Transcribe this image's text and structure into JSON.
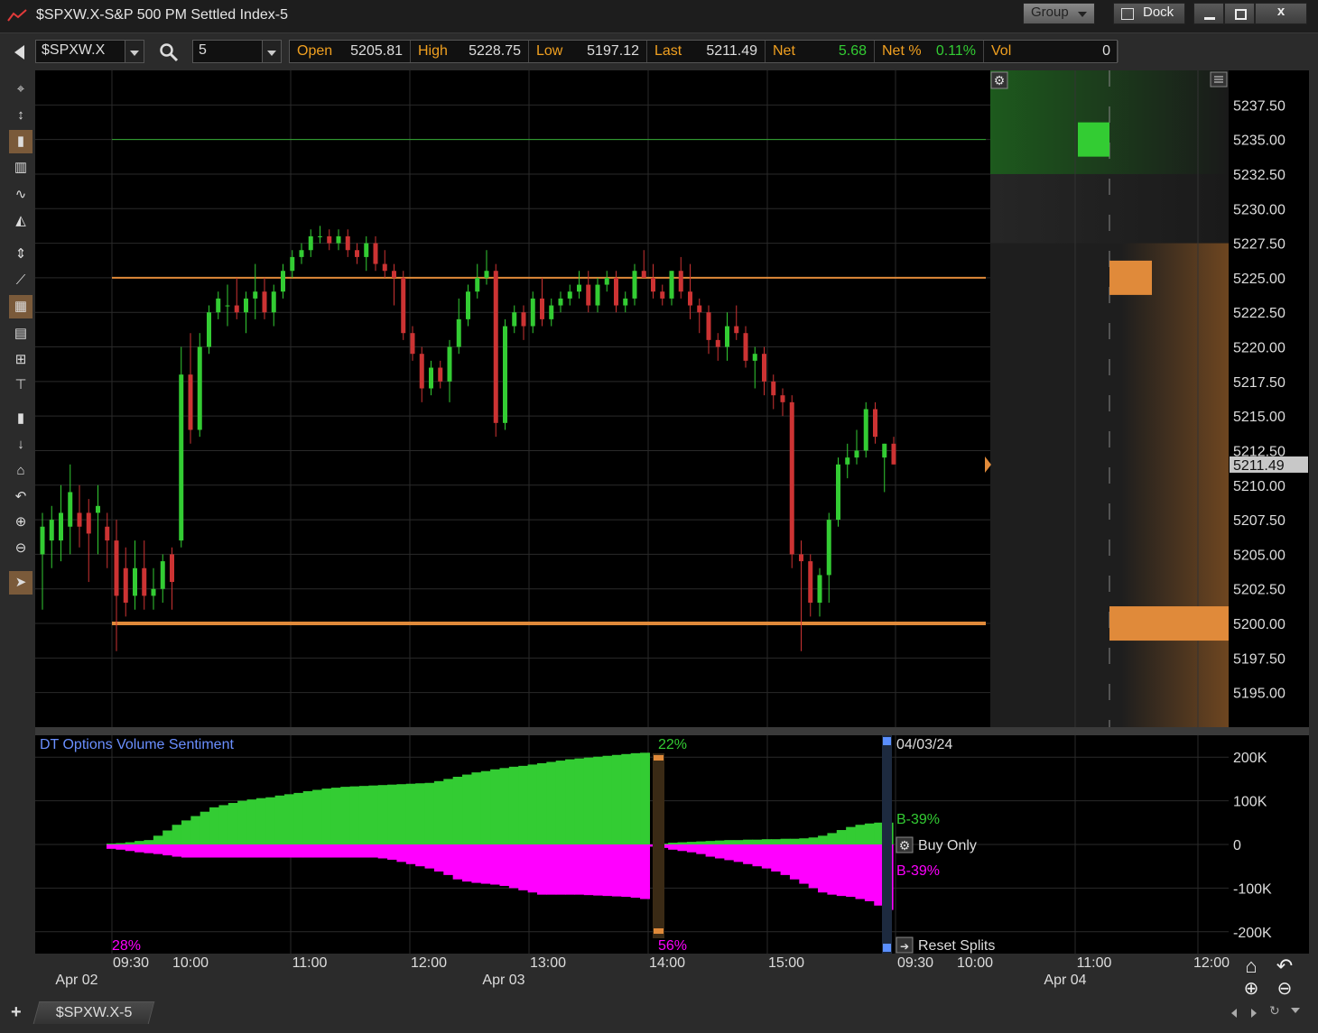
{
  "window": {
    "title": "$SPXW.X-S&P 500 PM Settled Index-5",
    "group_label": "Group",
    "dock_label": "Dock",
    "min_icon": "minimize-icon",
    "max_icon": "maximize-icon",
    "close_label": "x"
  },
  "toolbar": {
    "symbol": "$SPXW.X",
    "interval": "5",
    "quote": [
      {
        "label": "Open",
        "value": "5205.81",
        "color": "#dddddd"
      },
      {
        "label": "High",
        "value": "5228.75",
        "color": "#dddddd"
      },
      {
        "label": "Low",
        "value": "5197.12",
        "color": "#dddddd"
      },
      {
        "label": "Last",
        "value": "5211.49",
        "color": "#dddddd"
      },
      {
        "label": "Net",
        "value": "5.68",
        "color": "#33cc33"
      },
      {
        "label": "Net %",
        "value": "0.11%",
        "color": "#33cc33"
      },
      {
        "label": "Vol",
        "value": "0",
        "color": "#dddddd"
      }
    ]
  },
  "left_tools": [
    "crosshair-icon",
    "cursor-arrows-icon",
    "candlestick-icon",
    "bar-chart-icon",
    "line-chart-icon",
    "area-chart-icon",
    "fit-vertical-icon",
    "trendline-icon",
    "grid-icon",
    "table-icon",
    "small-grid-icon",
    "horizontal-line-icon",
    "scroll-right-icon",
    "scroll-down-icon",
    "home-icon",
    "undo-icon",
    "zoom-in-icon",
    "zoom-out-icon",
    "pointer-icon"
  ],
  "price_axis": {
    "ticks": [
      "5237.50",
      "5235.00",
      "5232.50",
      "5230.00",
      "5227.50",
      "5225.00",
      "5222.50",
      "5220.00",
      "5217.50",
      "5215.00",
      "5212.50",
      "5210.00",
      "5207.50",
      "5205.00",
      "5202.50",
      "5200.00",
      "5197.50",
      "5195.00"
    ],
    "last_price": "5211.49"
  },
  "indicator": {
    "title": "DT Options Volume Sentiment",
    "axis_ticks": [
      "200K",
      "100K",
      "0",
      "-100K",
      "-200K"
    ],
    "top_pct_1": "22%",
    "bottom_pct_0": "28%",
    "bottom_pct_1": "56%",
    "split_date": "04/03/24",
    "buy_label_top": "B-39%",
    "buy_label_bottom": "B-39%",
    "buy_only_label": "Buy Only",
    "reset_label": "Reset Splits"
  },
  "time_axis": {
    "times": [
      "09:30",
      "10:00",
      "11:00",
      "12:00",
      "13:00",
      "14:00",
      "15:00",
      "09:30",
      "10:00",
      "11:00",
      "12:00"
    ],
    "dates": [
      "Apr 02",
      "Apr 03",
      "Apr 04"
    ]
  },
  "tab": {
    "label": "$SPXW.X-5",
    "add_label": "+"
  },
  "colors": {
    "up": "#33cc33",
    "down": "#cc3333",
    "level": "#e08a3a",
    "green_line": "#33aa33",
    "magenta": "#ff00ff"
  },
  "chart_data": {
    "type": "candlestick",
    "price_range": [
      5192.5,
      5240.0
    ],
    "horizontal_lines": [
      5235.0,
      5225.0,
      5200.0
    ],
    "candles": [
      {
        "o": 5205,
        "h": 5208,
        "l": 5201,
        "c": 5207
      },
      {
        "o": 5206,
        "h": 5208.5,
        "l": 5204,
        "c": 5207.5
      },
      {
        "o": 5206,
        "h": 5210,
        "l": 5204.5,
        "c": 5208
      },
      {
        "o": 5207,
        "h": 5211.5,
        "l": 5205,
        "c": 5209.5
      },
      {
        "o": 5208,
        "h": 5210,
        "l": 5205.5,
        "c": 5207
      },
      {
        "o": 5208,
        "h": 5209,
        "l": 5203,
        "c": 5206.5
      },
      {
        "o": 5208,
        "h": 5210,
        "l": 5205,
        "c": 5208.5
      },
      {
        "o": 5207,
        "h": 5208,
        "l": 5204,
        "c": 5206
      },
      {
        "o": 5206,
        "h": 5207.5,
        "l": 5198,
        "c": 5202
      },
      {
        "o": 5204,
        "h": 5205.5,
        "l": 5200.5,
        "c": 5201.5
      },
      {
        "o": 5202,
        "h": 5206,
        "l": 5201,
        "c": 5204
      },
      {
        "o": 5204,
        "h": 5206,
        "l": 5201,
        "c": 5202
      },
      {
        "o": 5202,
        "h": 5204,
        "l": 5201,
        "c": 5202.5
      },
      {
        "o": 5202.5,
        "h": 5205,
        "l": 5201.5,
        "c": 5204.5
      },
      {
        "o": 5205,
        "h": 5205.5,
        "l": 5201,
        "c": 5203
      },
      {
        "o": 5206,
        "h": 5220,
        "l": 5205.5,
        "c": 5218
      },
      {
        "o": 5218,
        "h": 5221,
        "l": 5213,
        "c": 5214
      },
      {
        "o": 5214,
        "h": 5221,
        "l": 5213.5,
        "c": 5220
      },
      {
        "o": 5220,
        "h": 5223,
        "l": 5219.5,
        "c": 5222.5
      },
      {
        "o": 5222.5,
        "h": 5224,
        "l": 5222,
        "c": 5223.5
      },
      {
        "o": 5223,
        "h": 5224.5,
        "l": 5221.5,
        "c": 5223
      },
      {
        "o": 5223,
        "h": 5225,
        "l": 5222,
        "c": 5222.5
      },
      {
        "o": 5222.5,
        "h": 5224,
        "l": 5221,
        "c": 5223.5
      },
      {
        "o": 5223.5,
        "h": 5226,
        "l": 5222,
        "c": 5224
      },
      {
        "o": 5224,
        "h": 5225,
        "l": 5222,
        "c": 5222.5
      },
      {
        "o": 5222.5,
        "h": 5224.5,
        "l": 5221.5,
        "c": 5224
      },
      {
        "o": 5224,
        "h": 5226,
        "l": 5223.5,
        "c": 5225.5
      },
      {
        "o": 5225.5,
        "h": 5227,
        "l": 5225,
        "c": 5226.5
      },
      {
        "o": 5226.5,
        "h": 5227.5,
        "l": 5226,
        "c": 5227
      },
      {
        "o": 5227,
        "h": 5228.5,
        "l": 5226.5,
        "c": 5228
      },
      {
        "o": 5228,
        "h": 5228.75,
        "l": 5227.5,
        "c": 5228
      },
      {
        "o": 5228,
        "h": 5228.5,
        "l": 5227,
        "c": 5227.5
      },
      {
        "o": 5227.5,
        "h": 5228.5,
        "l": 5227,
        "c": 5228
      },
      {
        "o": 5228,
        "h": 5228.5,
        "l": 5226.5,
        "c": 5227
      },
      {
        "o": 5227,
        "h": 5227.5,
        "l": 5226,
        "c": 5226.5
      },
      {
        "o": 5226.5,
        "h": 5228,
        "l": 5225.5,
        "c": 5227.5
      },
      {
        "o": 5227.5,
        "h": 5228,
        "l": 5225.5,
        "c": 5226
      },
      {
        "o": 5226,
        "h": 5227,
        "l": 5225,
        "c": 5225.5
      },
      {
        "o": 5225.5,
        "h": 5226,
        "l": 5223,
        "c": 5225
      },
      {
        "o": 5225,
        "h": 5225.5,
        "l": 5220.5,
        "c": 5221
      },
      {
        "o": 5221,
        "h": 5221.5,
        "l": 5219,
        "c": 5219.5
      },
      {
        "o": 5219.5,
        "h": 5220,
        "l": 5216,
        "c": 5217
      },
      {
        "o": 5217,
        "h": 5219,
        "l": 5216.5,
        "c": 5218.5
      },
      {
        "o": 5218.5,
        "h": 5219,
        "l": 5217,
        "c": 5217.5
      },
      {
        "o": 5217.5,
        "h": 5220.5,
        "l": 5216,
        "c": 5220
      },
      {
        "o": 5220,
        "h": 5223.5,
        "l": 5219.5,
        "c": 5222
      },
      {
        "o": 5222,
        "h": 5224.5,
        "l": 5221.5,
        "c": 5224
      },
      {
        "o": 5224,
        "h": 5226,
        "l": 5223.5,
        "c": 5225
      },
      {
        "o": 5225,
        "h": 5227,
        "l": 5224.5,
        "c": 5225.5
      },
      {
        "o": 5225.5,
        "h": 5226,
        "l": 5213.5,
        "c": 5214.5
      },
      {
        "o": 5214.5,
        "h": 5222,
        "l": 5214,
        "c": 5221.5
      },
      {
        "o": 5221.5,
        "h": 5223,
        "l": 5221,
        "c": 5222.5
      },
      {
        "o": 5222.5,
        "h": 5223,
        "l": 5220.5,
        "c": 5221.5
      },
      {
        "o": 5221.5,
        "h": 5224,
        "l": 5221,
        "c": 5223.5
      },
      {
        "o": 5223.5,
        "h": 5225,
        "l": 5221.5,
        "c": 5222
      },
      {
        "o": 5222,
        "h": 5223.5,
        "l": 5221.5,
        "c": 5223
      },
      {
        "o": 5223,
        "h": 5224,
        "l": 5222.5,
        "c": 5223.5
      },
      {
        "o": 5223.5,
        "h": 5224.5,
        "l": 5223,
        "c": 5224
      },
      {
        "o": 5224,
        "h": 5225.5,
        "l": 5223.5,
        "c": 5224.5
      },
      {
        "o": 5224.5,
        "h": 5225.5,
        "l": 5222.5,
        "c": 5223
      },
      {
        "o": 5223,
        "h": 5225,
        "l": 5222.5,
        "c": 5224.5
      },
      {
        "o": 5224.5,
        "h": 5225.5,
        "l": 5224,
        "c": 5225
      },
      {
        "o": 5225,
        "h": 5225.5,
        "l": 5222.5,
        "c": 5223
      },
      {
        "o": 5223,
        "h": 5224,
        "l": 5222.5,
        "c": 5223.5
      },
      {
        "o": 5223.5,
        "h": 5226,
        "l": 5223,
        "c": 5225.5
      },
      {
        "o": 5225.5,
        "h": 5227,
        "l": 5225,
        "c": 5225
      },
      {
        "o": 5225,
        "h": 5226,
        "l": 5223.5,
        "c": 5224
      },
      {
        "o": 5224,
        "h": 5224.5,
        "l": 5223,
        "c": 5223.5
      },
      {
        "o": 5223.5,
        "h": 5225.5,
        "l": 5223,
        "c": 5225.5
      },
      {
        "o": 5225.5,
        "h": 5226.5,
        "l": 5223.5,
        "c": 5224
      },
      {
        "o": 5224,
        "h": 5226,
        "l": 5222,
        "c": 5223
      },
      {
        "o": 5223,
        "h": 5223.5,
        "l": 5221,
        "c": 5222.5
      },
      {
        "o": 5222.5,
        "h": 5223,
        "l": 5219.5,
        "c": 5220.5
      },
      {
        "o": 5220.5,
        "h": 5221,
        "l": 5219,
        "c": 5220
      },
      {
        "o": 5220,
        "h": 5222.5,
        "l": 5219,
        "c": 5221.5
      },
      {
        "o": 5221.5,
        "h": 5223,
        "l": 5220.5,
        "c": 5221
      },
      {
        "o": 5221,
        "h": 5221.5,
        "l": 5218.5,
        "c": 5219
      },
      {
        "o": 5219,
        "h": 5220,
        "l": 5217,
        "c": 5219.5
      },
      {
        "o": 5219.5,
        "h": 5220,
        "l": 5216.5,
        "c": 5217.5
      },
      {
        "o": 5217.5,
        "h": 5218,
        "l": 5215.5,
        "c": 5216.5
      },
      {
        "o": 5216.5,
        "h": 5217,
        "l": 5215,
        "c": 5216
      },
      {
        "o": 5216,
        "h": 5216.5,
        "l": 5204,
        "c": 5205
      },
      {
        "o": 5205,
        "h": 5206,
        "l": 5198,
        "c": 5204.5
      },
      {
        "o": 5204.5,
        "h": 5205,
        "l": 5200.5,
        "c": 5201.5
      },
      {
        "o": 5201.5,
        "h": 5204,
        "l": 5200.5,
        "c": 5203.5
      },
      {
        "o": 5203.5,
        "h": 5208,
        "l": 5201.5,
        "c": 5207.5
      },
      {
        "o": 5207.5,
        "h": 5212,
        "l": 5207,
        "c": 5211.5
      },
      {
        "o": 5211.5,
        "h": 5213,
        "l": 5210.5,
        "c": 5212
      },
      {
        "o": 5212,
        "h": 5214,
        "l": 5211.5,
        "c": 5212.5
      },
      {
        "o": 5212.5,
        "h": 5216,
        "l": 5212,
        "c": 5215.5
      },
      {
        "o": 5215.5,
        "h": 5216,
        "l": 5213,
        "c": 5213.5
      },
      {
        "o": 5212,
        "h": 5213,
        "l": 5209.5,
        "c": 5213
      },
      {
        "o": 5213,
        "h": 5213.5,
        "l": 5211.5,
        "c": 5211.5
      }
    ],
    "volume_profile": [
      {
        "price": 5235.0,
        "level": 0.34,
        "color": "#33cc33"
      },
      {
        "price": 5225.0,
        "level": 0.46,
        "color": "#e08a3a"
      },
      {
        "price": 5200.0,
        "level": 1.0,
        "color": "#e08a3a"
      }
    ],
    "sentiment_range": [
      -250000,
      250000
    ],
    "sentiment_buy": [
      2000,
      3000,
      5000,
      8000,
      10000,
      20000,
      32000,
      45000,
      55000,
      65000,
      75000,
      85000,
      90000,
      95000,
      100000,
      103000,
      106000,
      108000,
      112000,
      115000,
      118000,
      122000,
      125000,
      128000,
      130000,
      132000,
      133000,
      134000,
      135000,
      136000,
      137000,
      138000,
      139000,
      140000,
      141000,
      145000,
      150000,
      155000,
      160000,
      165000,
      168000,
      172000,
      175000,
      178000,
      180000,
      183000,
      186000,
      189000,
      192000,
      195000,
      197000,
      199000,
      201000,
      203000,
      205000,
      207000,
      209000,
      210000,
      0,
      2000,
      4000,
      5000,
      6000,
      7000,
      8000,
      9000,
      10000,
      10000,
      11000,
      11000,
      12000,
      12000,
      13000,
      13000,
      14000,
      16000,
      20000,
      26000,
      33000,
      40000,
      45000,
      48000,
      50000,
      50000
    ],
    "sentiment_sell": [
      -10000,
      -12000,
      -15000,
      -18000,
      -20000,
      -22000,
      -25000,
      -28000,
      -30000,
      -30000,
      -30000,
      -30000,
      -30000,
      -30000,
      -30000,
      -30000,
      -30000,
      -30000,
      -30000,
      -30000,
      -30000,
      -30000,
      -30000,
      -30000,
      -30000,
      -30000,
      -30000,
      -30000,
      -30000,
      -32000,
      -35000,
      -40000,
      -45000,
      -50000,
      -55000,
      -62000,
      -70000,
      -80000,
      -85000,
      -88000,
      -90000,
      -92000,
      -95000,
      -100000,
      -105000,
      -110000,
      -115000,
      -115000,
      -115000,
      -115000,
      -115000,
      -116000,
      -117000,
      -118000,
      -119000,
      -120000,
      -122000,
      -125000,
      -5000,
      -8000,
      -12000,
      -15000,
      -18000,
      -22000,
      -28000,
      -32000,
      -36000,
      -40000,
      -45000,
      -50000,
      -55000,
      -62000,
      -70000,
      -80000,
      -90000,
      -100000,
      -110000,
      -115000,
      -118000,
      -120000,
      -125000,
      -130000,
      -140000,
      -150000
    ]
  }
}
